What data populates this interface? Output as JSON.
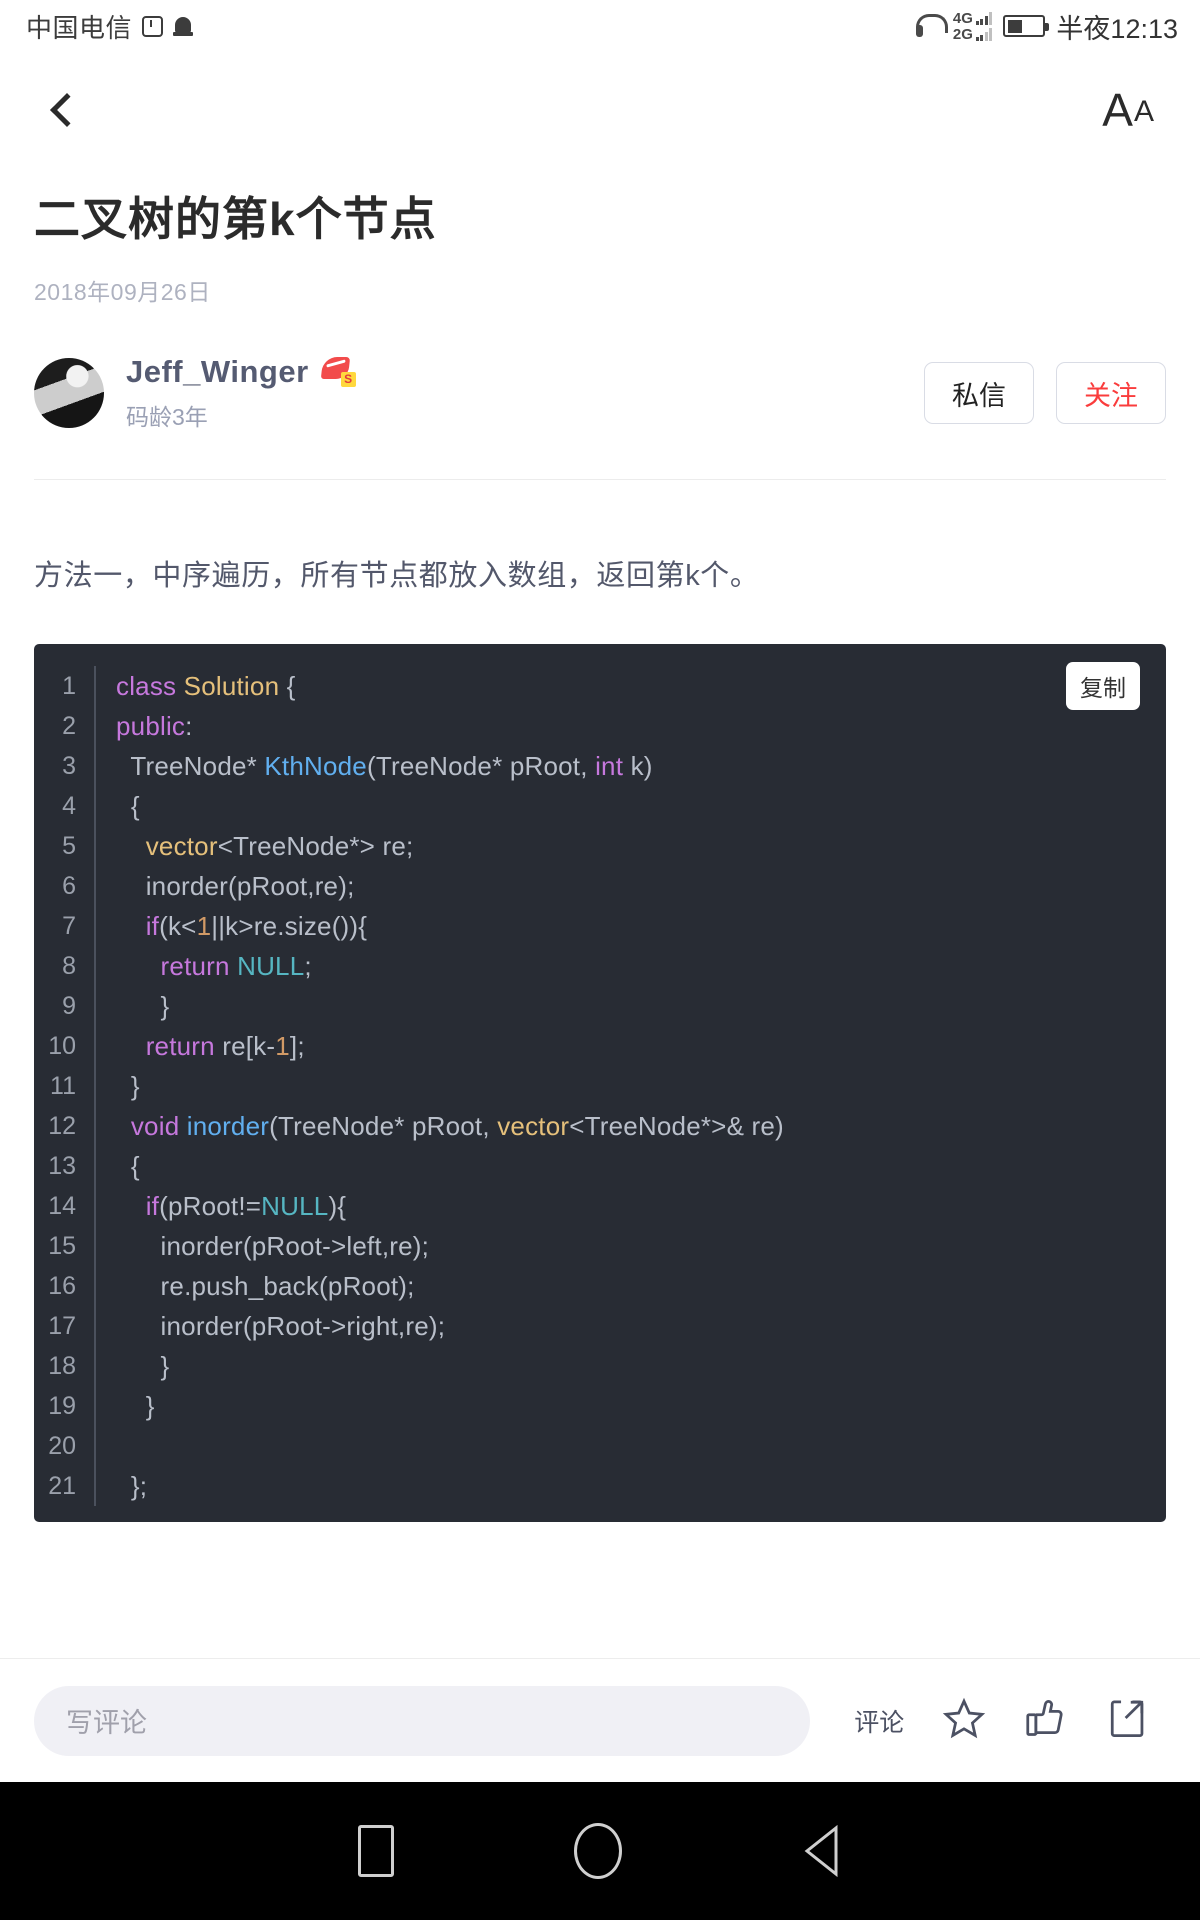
{
  "statusbar": {
    "carrier": "中国电信",
    "alarm_icon": "alarm-icon",
    "bell_icon": "bell-icon",
    "headset_icon": "headset-icon",
    "signal_primary": "4G",
    "signal_secondary": "2G",
    "battery_icon": "battery-icon",
    "time": "半夜12:13"
  },
  "navbar": {
    "back_icon": "back-chevron-icon",
    "font_size_label_big": "A",
    "font_size_label_small": "A"
  },
  "article": {
    "title": "二叉树的第k个节点",
    "date": "2018年09月26日",
    "author": {
      "name": "Jeff_Winger",
      "badge_letter": "S",
      "subtitle": "码龄3年"
    },
    "message_button": "私信",
    "follow_button": "关注",
    "paragraph": "方法一，中序遍历，所有节点都放入数组，返回第k个。"
  },
  "code_block": {
    "copy_label": "复制",
    "language": "cpp",
    "lines": [
      {
        "n": "1",
        "indent": 0,
        "tokens": [
          {
            "t": "class ",
            "c": "k"
          },
          {
            "t": "Solution",
            "c": "ty"
          },
          {
            "t": " {",
            "c": ""
          }
        ]
      },
      {
        "n": "2",
        "indent": 0,
        "tokens": [
          {
            "t": "public",
            "c": "k"
          },
          {
            "t": ":",
            "c": ""
          }
        ]
      },
      {
        "n": "3",
        "indent": 1,
        "tokens": [
          {
            "t": "TreeNode* ",
            "c": ""
          },
          {
            "t": "KthNode",
            "c": "fn"
          },
          {
            "t": "(TreeNode* pRoot, ",
            "c": ""
          },
          {
            "t": "int",
            "c": "k"
          },
          {
            "t": " k)",
            "c": ""
          }
        ]
      },
      {
        "n": "4",
        "indent": 1,
        "tokens": [
          {
            "t": "{",
            "c": ""
          }
        ]
      },
      {
        "n": "5",
        "indent": 2,
        "tokens": [
          {
            "t": "vector",
            "c": "ty"
          },
          {
            "t": "<TreeNode*> re;",
            "c": ""
          }
        ]
      },
      {
        "n": "6",
        "indent": 2,
        "tokens": [
          {
            "t": "inorder(pRoot,re);",
            "c": ""
          }
        ]
      },
      {
        "n": "7",
        "indent": 2,
        "tokens": [
          {
            "t": "if",
            "c": "k"
          },
          {
            "t": "(k<",
            "c": ""
          },
          {
            "t": "1",
            "c": "nu"
          },
          {
            "t": "||k>re.size()){",
            "c": ""
          }
        ]
      },
      {
        "n": "8",
        "indent": 3,
        "tokens": [
          {
            "t": "return ",
            "c": "k"
          },
          {
            "t": "NULL",
            "c": "cn"
          },
          {
            "t": ";",
            "c": ""
          }
        ]
      },
      {
        "n": "9",
        "indent": 3,
        "tokens": [
          {
            "t": "}",
            "c": ""
          }
        ]
      },
      {
        "n": "10",
        "indent": 2,
        "tokens": [
          {
            "t": "return ",
            "c": "k"
          },
          {
            "t": "re[k-",
            "c": ""
          },
          {
            "t": "1",
            "c": "nu"
          },
          {
            "t": "];",
            "c": ""
          }
        ]
      },
      {
        "n": "11",
        "indent": 1,
        "tokens": [
          {
            "t": "}",
            "c": ""
          }
        ]
      },
      {
        "n": "12",
        "indent": 1,
        "tokens": [
          {
            "t": "void ",
            "c": "k"
          },
          {
            "t": "inorder",
            "c": "fn"
          },
          {
            "t": "(TreeNode* pRoot, ",
            "c": ""
          },
          {
            "t": "vector",
            "c": "ty"
          },
          {
            "t": "<TreeNode*>& re)",
            "c": ""
          }
        ]
      },
      {
        "n": "13",
        "indent": 1,
        "tokens": [
          {
            "t": "{",
            "c": ""
          }
        ]
      },
      {
        "n": "14",
        "indent": 2,
        "tokens": [
          {
            "t": "if",
            "c": "k"
          },
          {
            "t": "(pRoot!=",
            "c": ""
          },
          {
            "t": "NULL",
            "c": "cn"
          },
          {
            "t": "){",
            "c": ""
          }
        ]
      },
      {
        "n": "15",
        "indent": 3,
        "tokens": [
          {
            "t": "inorder(pRoot->left,re);",
            "c": ""
          }
        ]
      },
      {
        "n": "16",
        "indent": 3,
        "tokens": [
          {
            "t": "re.push_back(pRoot);",
            "c": ""
          }
        ]
      },
      {
        "n": "17",
        "indent": 3,
        "tokens": [
          {
            "t": "inorder(pRoot->right,re);",
            "c": ""
          }
        ]
      },
      {
        "n": "18",
        "indent": 3,
        "tokens": [
          {
            "t": "}",
            "c": ""
          }
        ]
      },
      {
        "n": "19",
        "indent": 2,
        "tokens": [
          {
            "t": "}",
            "c": ""
          }
        ]
      },
      {
        "n": "20",
        "indent": 0,
        "tokens": [
          {
            "t": "",
            "c": ""
          }
        ]
      },
      {
        "n": "21",
        "indent": 1,
        "tokens": [
          {
            "t": "};",
            "c": ""
          }
        ]
      }
    ]
  },
  "bottombar": {
    "comment_placeholder": "写评论",
    "comment_label": "评论",
    "star_icon": "star-icon",
    "like_icon": "thumbs-up-icon",
    "share_icon": "share-icon"
  },
  "androidnav": {
    "recents_icon": "recents-square-icon",
    "home_icon": "home-circle-icon",
    "back_icon": "back-triangle-icon"
  },
  "colors": {
    "accent_red": "#fa3c3c",
    "code_bg": "#282c34",
    "author_name": "#555b72"
  }
}
